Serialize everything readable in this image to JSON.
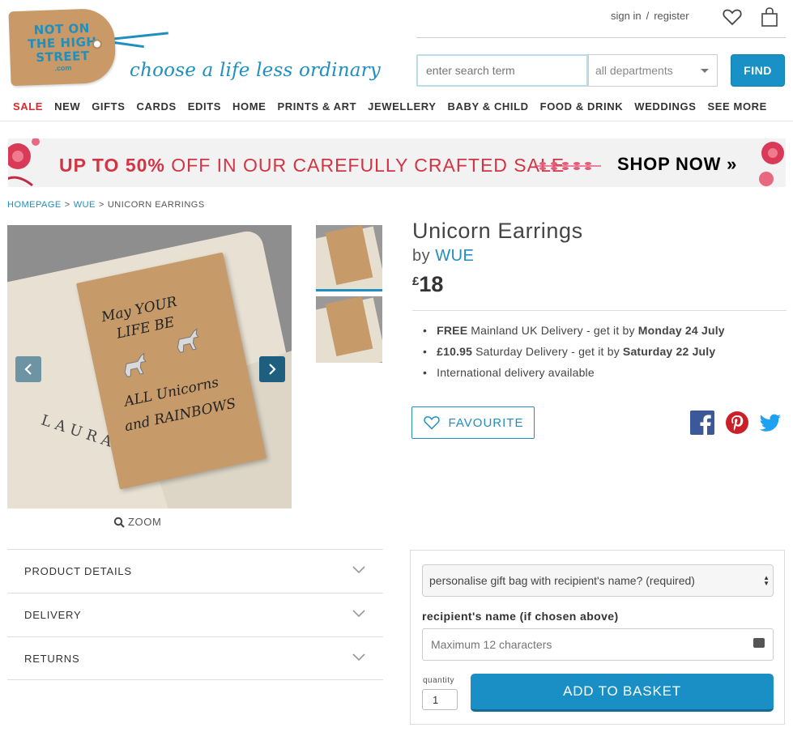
{
  "header": {
    "logo_lines": [
      "NOT ON",
      "THE HIGH",
      "STREET"
    ],
    "logo_suffix": ".com",
    "tagline": "choose a life less ordinary",
    "sign_in": "sign in",
    "separator": "/",
    "register": "register",
    "search_placeholder": "enter search term",
    "department": "all departments",
    "find_label": "FIND"
  },
  "nav": {
    "items": [
      "SALE",
      "NEW",
      "GIFTS",
      "CARDS",
      "EDITS",
      "HOME",
      "PRINTS & ART",
      "JEWELLERY",
      "BABY & CHILD",
      "FOOD & DRINK",
      "WEDDINGS",
      "SEE MORE"
    ]
  },
  "banner": {
    "highlight": "UP TO 50%",
    "text": " OFF IN OUR CAREFULLY CRAFTED SALE",
    "cta": "SHOP NOW »"
  },
  "breadcrumb": {
    "home": "HOMEPAGE",
    "sep": ">",
    "seller": "WUE",
    "current": "UNICORN EARRINGS"
  },
  "gallery": {
    "card_lines": [
      "May YOUR",
      "LIFE BE",
      "ALL Unicorns",
      "and RAINBOWS"
    ],
    "bag_name": "LAURA",
    "zoom_label": "ZOOM"
  },
  "product": {
    "title": "Unicorn Earrings",
    "by": "by",
    "seller": "WUE",
    "currency": "£",
    "price": "18",
    "delivery": [
      {
        "bold": "FREE",
        "text": "Mainland UK Delivery - get it by",
        "date": "Monday 24 July"
      },
      {
        "bold": "£10.95",
        "text": "Saturday Delivery - get it by",
        "date": "Saturday 22 July"
      },
      {
        "bold": "",
        "text": "International delivery available",
        "date": ""
      }
    ],
    "favourite_label": "FAVOURITE"
  },
  "accordions": {
    "details": "PRODUCT DETAILS",
    "delivery": "DELIVERY",
    "returns": "RETURNS"
  },
  "purchase": {
    "personalise_option": "personalise gift bag with recipient's name? (required)",
    "recipient_label": "recipient's name (if chosen above)",
    "recipient_placeholder": "Maximum 12 characters",
    "quantity_label": "quantity",
    "quantity_value": "1",
    "add_label": "ADD TO BASKET"
  },
  "colors": {
    "brand_blue": "#1e8fbf",
    "sale_red": "#d8292f",
    "banner_red": "#d33443"
  }
}
